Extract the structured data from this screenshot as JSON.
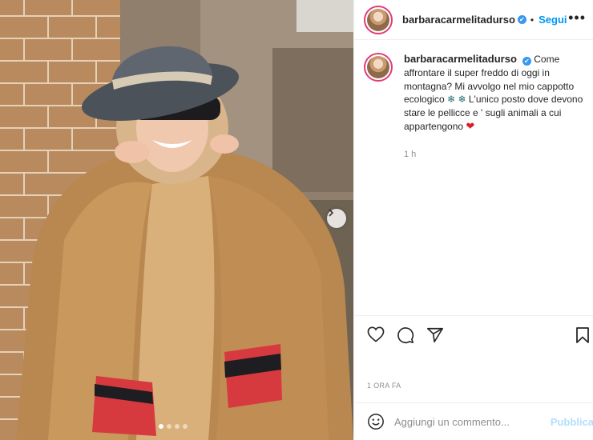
{
  "post": {
    "username": "barbaracarmelitadurso",
    "verified_glyph": "✔",
    "separator": "•",
    "follow_label": "Segui",
    "more_label": "•••",
    "caption": {
      "text_part1": "Come affrontare il super freddo di oggi in montagna? Mi avvolgo nel mio cappotto ecologico",
      "snowflake": "❄",
      "text_part2": "L'unico posto dove devono stare le pellicce e ' sugli animali a cui appartengono",
      "heart": "❤"
    },
    "time_ago": "1 h",
    "date_label": "1 ORA FA",
    "comment": {
      "placeholder": "Aggiungi un commento...",
      "publish_label": "Pubblica"
    }
  },
  "media": {
    "description_icon": "carousel-next-icon",
    "carousel_count": 4,
    "active_index": 0
  },
  "colors": {
    "link_blue": "#0095f6",
    "publish_disabled": "#b2dffc",
    "verified_blue": "#3897f0",
    "story_ring": "#e23a7a",
    "muted": "#8e8e8e"
  }
}
